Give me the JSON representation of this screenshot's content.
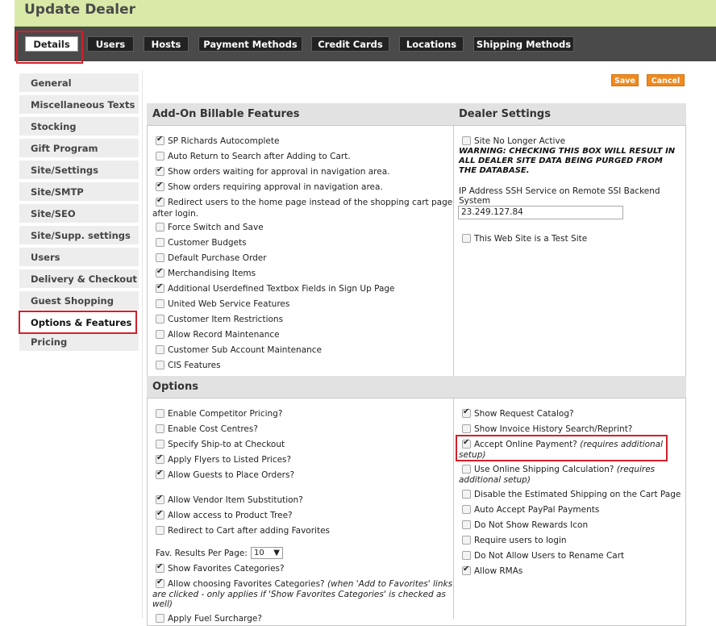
{
  "page": {
    "title": "Update Dealer"
  },
  "tabs": [
    "Details",
    "Users",
    "Hosts",
    "Payment Methods",
    "Credit Cards",
    "Locations",
    "Shipping Methods"
  ],
  "sidebar": {
    "items": [
      "General",
      "Miscellaneous Texts",
      "Stocking",
      "Gift Program",
      "Site/Settings",
      "Site/SMTP",
      "Site/SEO",
      "Site/Supp. settings",
      "Users",
      "Delivery & Checkout",
      "Guest Shopping",
      "Options & Features",
      "Pricing"
    ]
  },
  "toolbar": {
    "save_label": "Save",
    "cancel_label": "Cancel"
  },
  "addon": {
    "header": "Add-On Billable Features",
    "items": [
      {
        "label": "SP Richards Autocomplete",
        "checked": true
      },
      {
        "label": "Auto Return to Search after Adding to Cart.",
        "checked": false
      },
      {
        "label": "Show orders waiting for approval in navigation area.",
        "checked": true
      },
      {
        "label": "Show orders requiring approval in navigation area.",
        "checked": true
      },
      {
        "label": "Redirect users to the home page instead of the shopping cart page",
        "label2": "after login.",
        "checked": true
      },
      {
        "label": "Force Switch and Save",
        "checked": false
      },
      {
        "label": "Customer Budgets",
        "checked": false
      },
      {
        "label": "Default Purchase Order",
        "checked": false
      },
      {
        "label": "Merchandising Items",
        "checked": true
      },
      {
        "label": "Additional Userdefined Textbox Fields in Sign Up Page",
        "checked": true
      },
      {
        "label": "United Web Service Features",
        "checked": false
      },
      {
        "label": "Customer Item Restrictions",
        "checked": false
      },
      {
        "label": "Allow Record Maintenance",
        "checked": false
      },
      {
        "label": "Customer Sub Account Maintenance",
        "checked": false
      },
      {
        "label": "CIS Features",
        "checked": false
      }
    ]
  },
  "dealer": {
    "header": "Dealer Settings",
    "no_longer_active": "Site No Longer Active",
    "warning": [
      "WARNING: CHECKING THIS BOX WILL RESULT IN",
      "ALL DEALER SITE DATA BEING PURGED FROM",
      "THE DATABASE."
    ],
    "ip_label": [
      "IP Address SSH Service on Remote SSI Backend",
      "System"
    ],
    "ip_value": "23.249.127.84",
    "test_site": "This Web Site is a Test Site"
  },
  "options": {
    "header": "Options",
    "left": [
      {
        "label": "Enable Competitor Pricing?",
        "checked": false
      },
      {
        "label": "Enable Cost Centres?",
        "checked": false
      },
      {
        "label": "Specify Ship-to at Checkout",
        "checked": false
      },
      {
        "label": "Apply Flyers to Listed Prices?",
        "checked": true
      },
      {
        "label": "Allow Guests to Place Orders?",
        "checked": true
      },
      {
        "label": "Allow Vendor Item Substitution?",
        "checked": true
      },
      {
        "label": "Allow access to Product Tree?",
        "checked": true
      },
      {
        "label": "Redirect to Cart after adding Favorites",
        "checked": false
      }
    ],
    "fav_label": "Fav. Results Per Page:",
    "fav_value": "10",
    "show_fav_categories": "Show Favorites Categories?",
    "allow_fav": "Allow choosing Favorites Categories?",
    "allow_fav_note1": "(when 'Add to Favorites' links",
    "allow_fav_note2": "are clicked - only applies if 'Show Favorites Categories' is checked as",
    "allow_fav_note3": "well)",
    "fuel": "Apply Fuel Surcharge?",
    "right": [
      {
        "label": "Show Request Catalog?",
        "checked": true
      },
      {
        "label": "Show Invoice History Search/Reprint?",
        "checked": false
      },
      {
        "label": "Accept Online Payment?",
        "note": "(requires additional",
        "note2": "setup)",
        "checked": true
      },
      {
        "label": "Use Online Shipping Calculation?",
        "note": "(requires",
        "note2": "additional setup)",
        "checked": false
      },
      {
        "label": "Disable the Estimated Shipping on the Cart Page",
        "checked": false
      },
      {
        "label": "Auto Accept PayPal Payments",
        "checked": false
      },
      {
        "label": "Do Not Show Rewards Icon",
        "checked": false
      },
      {
        "label": "Require users to login",
        "checked": false
      },
      {
        "label": "Do Not Allow Users to Rename Cart",
        "checked": false
      },
      {
        "label": "Allow RMAs",
        "checked": true
      }
    ]
  }
}
